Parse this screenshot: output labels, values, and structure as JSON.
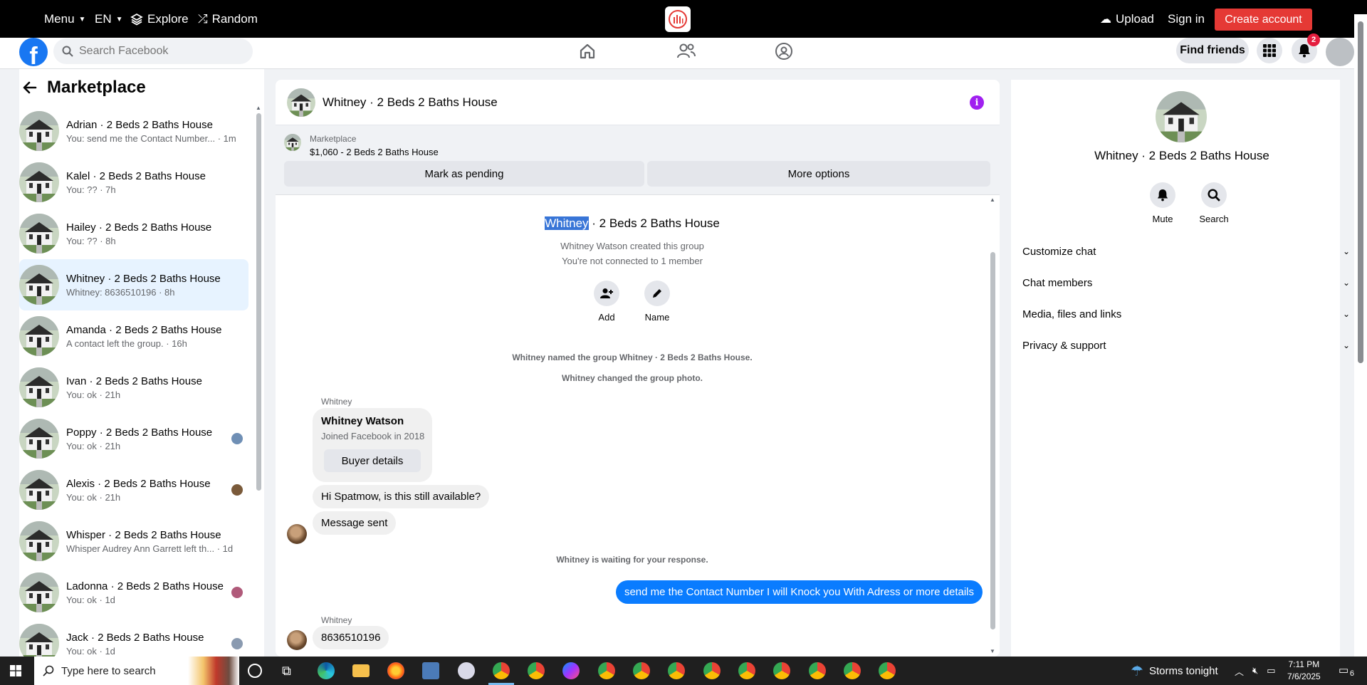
{
  "topbar": {
    "menu": "Menu",
    "lang": "EN",
    "explore": "Explore",
    "random": "Random",
    "upload": "Upload",
    "signin": "Sign in",
    "create_account": "Create account"
  },
  "fbnav": {
    "search_placeholder": "Search Facebook",
    "find_friends": "Find friends",
    "notif_count": "2"
  },
  "sidebar": {
    "title": "Marketplace",
    "conversations": [
      {
        "name": "Adrian · 2 Beds 2 Baths House",
        "preview": "You: send me the Contact Number... · 1m"
      },
      {
        "name": "Kalel · 2 Beds 2 Baths House",
        "preview": "You: ?? · 7h"
      },
      {
        "name": "Hailey · 2 Beds 2 Baths House",
        "preview": "You: ?? · 8h"
      },
      {
        "name": "Whitney · 2 Beds 2 Baths House",
        "preview": "Whitney: 8636510196 · 8h"
      },
      {
        "name": "Amanda · 2 Beds 2 Baths House",
        "preview": "A contact left the group. · 16h"
      },
      {
        "name": "Ivan · 2 Beds 2 Baths House",
        "preview": "You: ok · 21h"
      },
      {
        "name": "Poppy · 2 Beds 2 Baths House",
        "preview": "You: ok · 21h"
      },
      {
        "name": "Alexis · 2 Beds 2 Baths House",
        "preview": "You: ok · 21h"
      },
      {
        "name": "Whisper · 2 Beds 2 Baths House",
        "preview": "Whisper Audrey Ann Garrett left th... · 1d"
      },
      {
        "name": "Ladonna · 2 Beds 2 Baths House",
        "preview": "You: ok · 1d"
      },
      {
        "name": "Jack · 2 Beds 2 Baths House",
        "preview": "You: ok · 1d"
      }
    ]
  },
  "chat": {
    "header_title": "Whitney · 2 Beds 2 Baths House",
    "marketplace_label": "Marketplace",
    "listing": "$1,060 - 2 Beds 2 Baths House",
    "mark_pending": "Mark as pending",
    "more_options": "More options",
    "group_title_highlight": "Whitney",
    "group_title_rest": " · 2 Beds 2 Baths House",
    "created_by": "Whitney Watson created this group",
    "not_connected": "You're not connected to 1 member",
    "add_label": "Add",
    "name_label": "Name",
    "named_group": "Whitney named the group Whitney · 2 Beds 2 Baths House.",
    "changed_photo": "Whitney changed the group photo.",
    "sender1": "Whitney",
    "card_name": "Whitney Watson",
    "card_joined": "Joined Facebook in 2018",
    "buyer_details": "Buyer details",
    "msg1": "Hi Spatmow, is this still available?",
    "msg2": "Message sent",
    "waiting": "Whitney is waiting for your response.",
    "outgoing": "send me the Contact Number I will Knock you With Adress or more details",
    "sender2": "Whitney",
    "msg3": "8636510196"
  },
  "info": {
    "name": "Whitney · 2 Beds 2 Baths House",
    "mute": "Mute",
    "search": "Search",
    "rows": [
      "Customize chat",
      "Chat members",
      "Media, files and links",
      "Privacy & support"
    ]
  },
  "taskbar": {
    "search_placeholder": "Type here to search",
    "weather": "Storms tonight",
    "time": "7:11 PM",
    "date": "7/6/2025",
    "notif_count": "6"
  },
  "colors": {
    "fb_blue": "#1877f2",
    "messenger_blue": "#0a7cff",
    "create_red": "#e53935",
    "info_purple": "#a020f0"
  }
}
